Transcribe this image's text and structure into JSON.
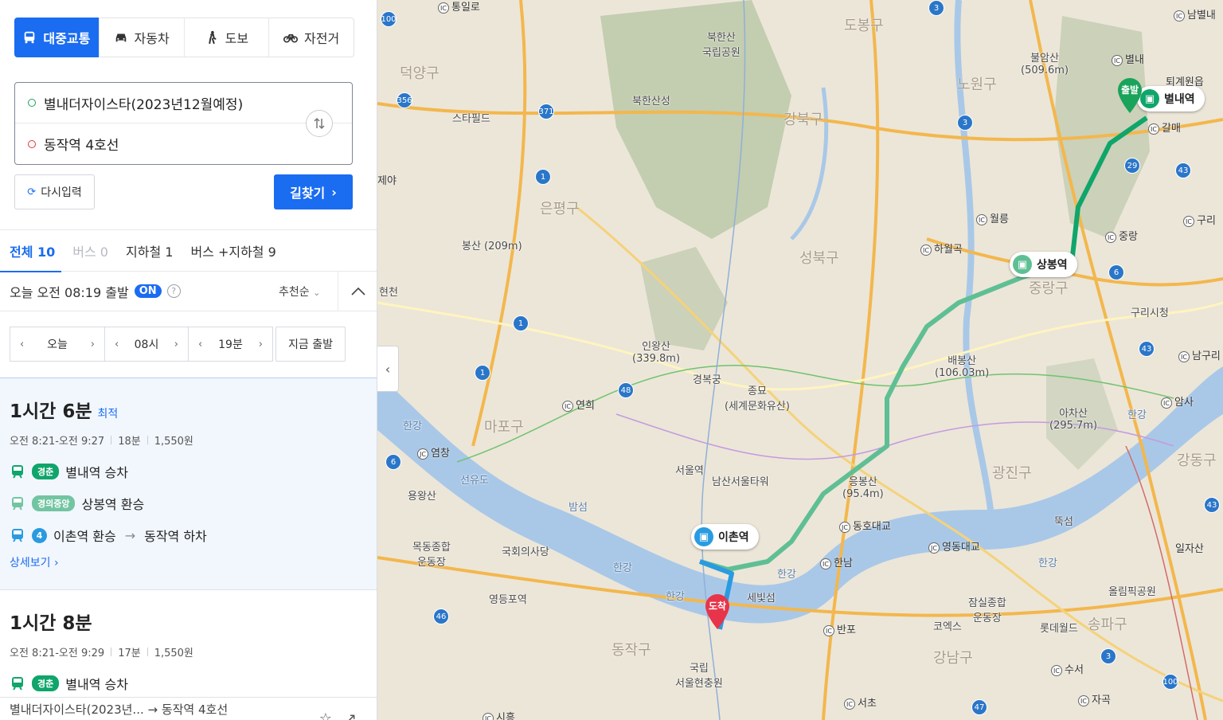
{
  "modes": [
    {
      "label": "대중교통",
      "icon": "bus-icon",
      "active": true
    },
    {
      "label": "자동차",
      "icon": "car-icon",
      "active": false
    },
    {
      "label": "도보",
      "icon": "walk-icon",
      "active": false
    },
    {
      "label": "자전거",
      "icon": "bicycle-icon",
      "active": false
    }
  ],
  "route": {
    "origin": "별내더자이스타(2023년12월예정)",
    "destination": "동작역 4호선",
    "reset_label": "다시입력",
    "search_label": "길찾기"
  },
  "filters": [
    {
      "label": "전체 10",
      "state": "active"
    },
    {
      "label": "버스 0",
      "state": "disabled"
    },
    {
      "label": "지하철 1",
      "state": "normal"
    },
    {
      "label": "버스 +지하철 9",
      "state": "normal"
    }
  ],
  "departure": {
    "text": "오늘 오전 08:19 출발",
    "toggle": "ON",
    "help": "?",
    "sort_label": "추천순"
  },
  "time_controls": {
    "day": "오늘",
    "hour": "08시",
    "minute": "19분",
    "now_label": "지금 출발"
  },
  "results": [
    {
      "duration": "1시간 6분",
      "best_label": "최적",
      "time_range": "오전 8:21-오전 9:27",
      "walk": "18분",
      "fare": "1,550원",
      "steps": [
        {
          "badge": "경춘",
          "text": "별내역 승차"
        },
        {
          "badge": "경의중앙",
          "text": "상봉역 환승"
        },
        {
          "badge": "4",
          "text": "이촌역 환승",
          "text2": "동작역 하차"
        }
      ],
      "detail_label": "상세보기"
    },
    {
      "duration": "1시간 8분",
      "time_range": "오전 8:21-오전 9:29",
      "walk": "17분",
      "fare": "1,550원",
      "steps": [
        {
          "badge": "경춘",
          "text": "별내역 승차"
        }
      ]
    }
  ],
  "bottom_bar": {
    "text": "별내더자이스타(2023년... → 동작역 4호선"
  },
  "map": {
    "stations": {
      "byeollae": "별내역",
      "sangbong": "상봉역",
      "ichon": "이촌역"
    },
    "pins": {
      "start": "출발",
      "end": "도착"
    },
    "labels": {
      "dobong": "도봉구",
      "nowon": "노원구",
      "gangbuk": "강북구",
      "seongbuk": "성북구",
      "jungnang": "중랑구",
      "eunpyeong": "은평구",
      "mapo": "마포구",
      "gwangjin": "광진구",
      "gangdong": "강동구",
      "songpa": "송파구",
      "gangnam": "강남구",
      "dongjak": "동작구",
      "deogyang": "덕양구",
      "bukhansan": "북한산\n국립공원",
      "bukhansanseong": "북한산성",
      "starfield": "스타필드",
      "bulamsan": "불암산\n(509.6m)",
      "bongsan": "봉산 (209m)",
      "inwangsan": "인왕산\n(339.8m)",
      "gyeongbokgung": "경복궁",
      "jongmyo": "종묘\n(세계문화유산)",
      "baebongsan": "배봉산\n(106.03m)",
      "achasan": "아차산\n(295.7m)",
      "seoulstation": "서울역",
      "namsan": "남산서울타워",
      "eungbongsan": "응봉산\n(95.4m)",
      "national_assembly": "국회의사당",
      "mokdong": "목동종합\n운동장",
      "yongwangsan": "용왕산",
      "yeongdeungpo": "영등포역",
      "cemetery": "국립\n서울현충원",
      "jamsil": "잠실종합\n운동장",
      "coex": "코엑스",
      "lotteworld": "롯데월드",
      "olympic": "올림픽공원",
      "guri_city": "구리시청",
      "ttukseom": "뚝섬",
      "hangang1": "한강",
      "hangang2": "한강",
      "hangang3": "한강",
      "hangang4": "한강",
      "hangang5": "한강",
      "hangang6": "한강",
      "seonyudo": "선유도",
      "bamseom": "밤섬",
      "saebit": "세빛섬",
      "sinmyeong": "현천",
      "byeollae_ic": "별내",
      "toegyewon": "퇴계원읍",
      "namyangju": "남별내",
      "galmae": "갈매",
      "guri": "구리",
      "jungrang": "중랑",
      "wolreung": "월릉",
      "hawolgok": "하월곡",
      "yeonhui": "연희",
      "yeomchang": "염창",
      "dongho": "동호대교",
      "hannam": "한남",
      "yeongdong": "영동대교",
      "banpo": "반포",
      "seocho": "서초",
      "suseo": "수서",
      "jagok": "자곡",
      "amsa": "암사",
      "namguri": "남구리",
      "ilja": "일자산",
      "tongilro": "통일로",
      "jaeya": "제야",
      "sinsu": "시흥"
    }
  }
}
